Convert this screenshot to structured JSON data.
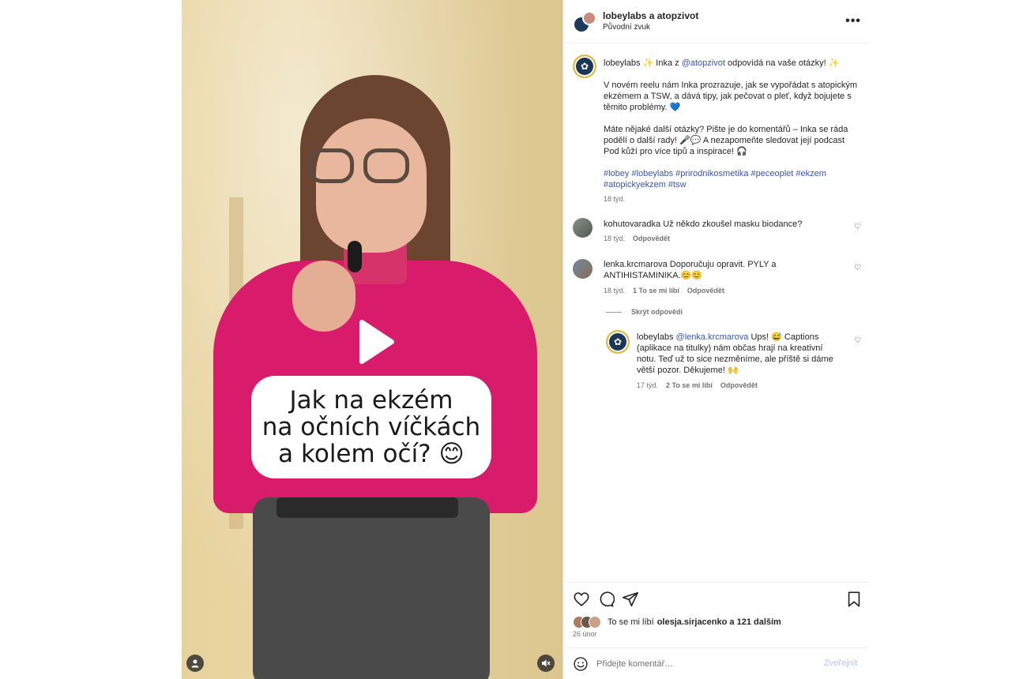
{
  "video": {
    "caption_text": "Jak na ekzém\nna očních víčkách\na kolem očí? 😊",
    "profile_icon": "user-icon",
    "mute_icon": "speaker-muted-icon",
    "play_icon": "play-icon"
  },
  "header": {
    "title": "lobeylabs a atopzivot",
    "subtitle": "Původní zvuk",
    "more_icon": "ellipsis-icon",
    "more_label": "•••"
  },
  "post": {
    "username": "lobeylabs",
    "line1_a": "✨ Inka z ",
    "line1_mention": "@atopzivot",
    "line1_b": " odpovídá na vaše otázky! ✨",
    "para2": "V novém reelu nám Inka prozrazuje, jak se vypořádat s atopickým ekzémem a TSW, a dává tipy, jak pečovat o pleť, když bojujete s těmito problémy. 💙",
    "para3": "Máte nějaké další otázky? Pište je do komentářů – Inka se ráda podělí o další rady! 🎤💬 A nezapomeňte sledovat její podcast Pod kůží pro více tipů a inspirace! 🎧",
    "hashtags": "#lobey #lobeylabs #prirodnikosmetika #peceoplet #ekzem #atopickyekzem #tsw",
    "time": "18 týd."
  },
  "comments": [
    {
      "username": "kohutovaradka",
      "text": "Už někdo zkoušel masku biodance?",
      "time": "18 týd.",
      "reply": "Odpovědět"
    },
    {
      "username": "lenka.krcmarova",
      "text": "Doporučuju opravit. PYLY a ANTIHISTAMINIKA.😊😊",
      "time": "18 týd.",
      "likes": "1 To se mi líbí",
      "reply": "Odpovědět"
    }
  ],
  "hide_replies": "Skrýt odpovědí",
  "reply": {
    "username": "lobeylabs",
    "mention": "@lenka.krcmarova",
    "text": " Ups! 😅 Captions (aplikace na titulky) nám občas hrají na kreativní notu. Teď už to sice nezměníme, ale příště si dáme větší pozor. Děkujeme! 🙌",
    "time": "17 týd.",
    "likes": "2 To se mi líbí",
    "reply": "Odpovědět"
  },
  "actions": {
    "like_icon": "heart-icon",
    "comment_icon": "comment-icon",
    "share_icon": "send-icon",
    "save_icon": "bookmark-icon",
    "likes_prefix": "To se mi líbí ",
    "likes_text": "olesja.sirjacenko a 121 dalším",
    "date": "26 únor"
  },
  "composer": {
    "emoji_icon": "smiley-icon",
    "placeholder": "Přidejte komentář…",
    "post_label": "Zveřejnit"
  },
  "colors": {
    "link": "#3b53b5",
    "brand_navy": "#1c3656",
    "post_button_disabled": "#b2c7f0",
    "sweater": "#d81b6a"
  }
}
